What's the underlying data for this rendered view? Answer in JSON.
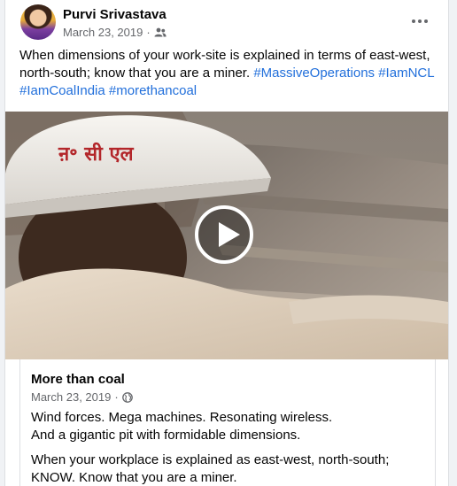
{
  "post": {
    "author": "Purvi Srivastava",
    "date": "March 23, 2019",
    "separator": "·",
    "audience_icon": "friends-icon",
    "more_icon": "more-options-icon",
    "text_plain": "When dimensions of your work-site is explained in terms of east-west, north-south; know that you are a miner. ",
    "hashtags": [
      "#MassiveOperations",
      "#IamNCL",
      "#IamCoalIndia",
      "#morethancoal"
    ]
  },
  "video": {
    "helmet_text": "ऩ॰ सी एल",
    "play_icon": "play-icon"
  },
  "link_card": {
    "title": "More than coal",
    "date": "March 23, 2019",
    "separator": "·",
    "audience_icon": "globe-icon",
    "line1": "Wind forces. Mega machines. Resonating wireless.",
    "line2": "And a gigantic pit with formidable dimensions.",
    "line3": "When your workplace is explained as east-west, north-south;",
    "line4": "KNOW.  Know that you are a miner."
  },
  "colors": {
    "link": "#216fdb",
    "secondary_text": "#65676b",
    "background": "#f0f2f5"
  }
}
